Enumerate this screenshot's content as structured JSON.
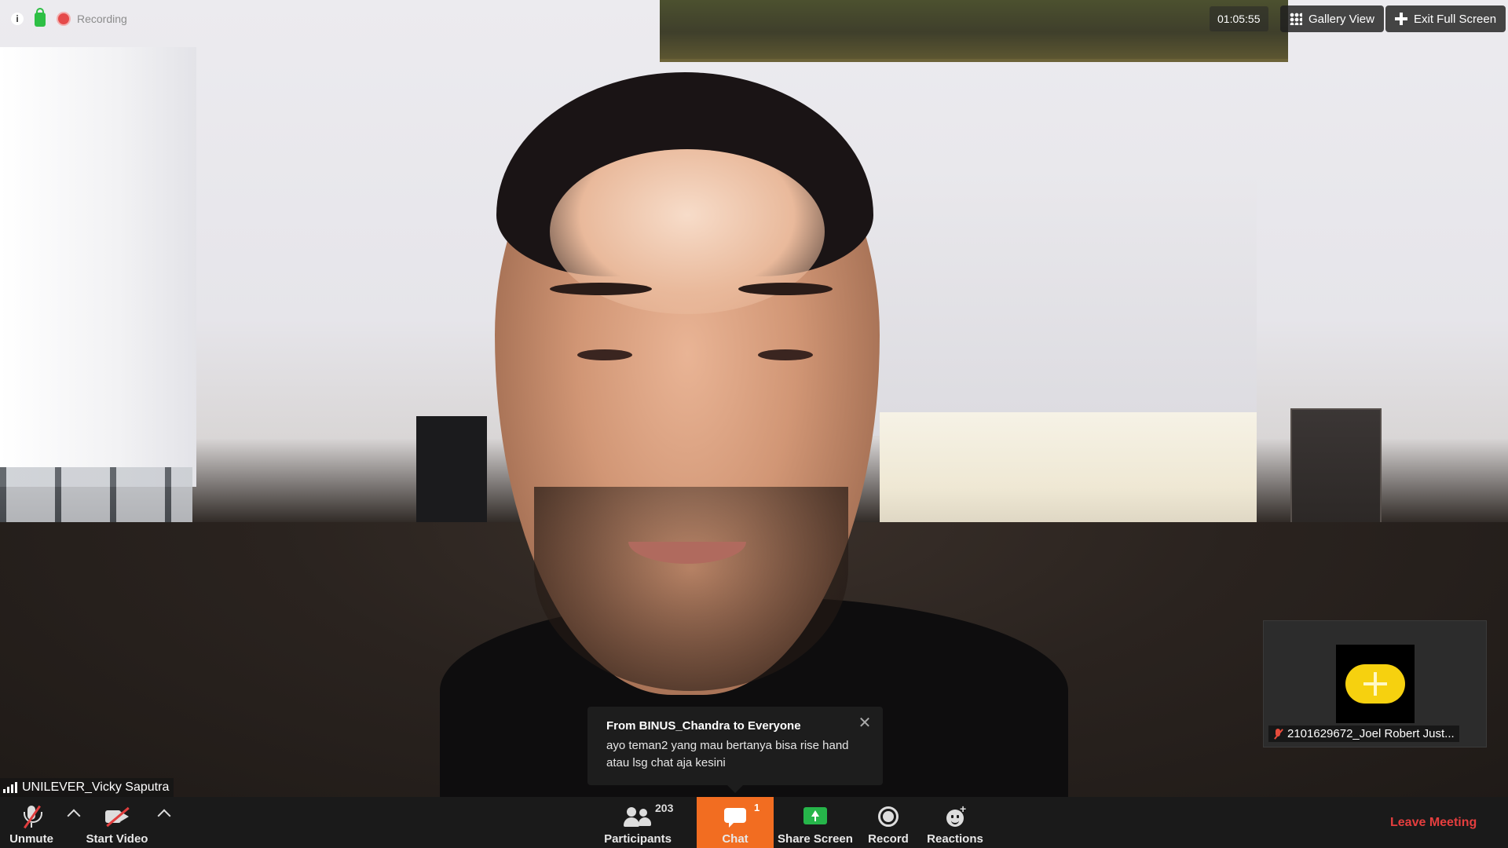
{
  "top_bar": {
    "recording_label": "Recording",
    "timer": "01:05:55",
    "gallery_view_label": "Gallery View",
    "exit_full_screen_label": "Exit Full Screen"
  },
  "chat_toast": {
    "title": "From BINUS_Chandra to Everyone",
    "message": "ayo teman2 yang mau bertanya bisa rise hand atau lsg chat aja kesini"
  },
  "self_view": {
    "name": "2101629672_Joel Robert Just..."
  },
  "speaker": {
    "name": "UNILEVER_Vicky Saputra"
  },
  "toolbar": {
    "unmute_label": "Unmute",
    "start_video_label": "Start Video",
    "participants_label": "Participants",
    "participants_count": "203",
    "chat_label": "Chat",
    "chat_badge": "1",
    "share_screen_label": "Share Screen",
    "record_label": "Record",
    "reactions_label": "Reactions",
    "leave_meeting_label": "Leave Meeting"
  },
  "colors": {
    "chat_active": "#f26d21",
    "leave": "#e53e3e",
    "share_green": "#26b54a",
    "muted_red": "#e03e3e",
    "avatar_yellow": "#f6d10f"
  }
}
